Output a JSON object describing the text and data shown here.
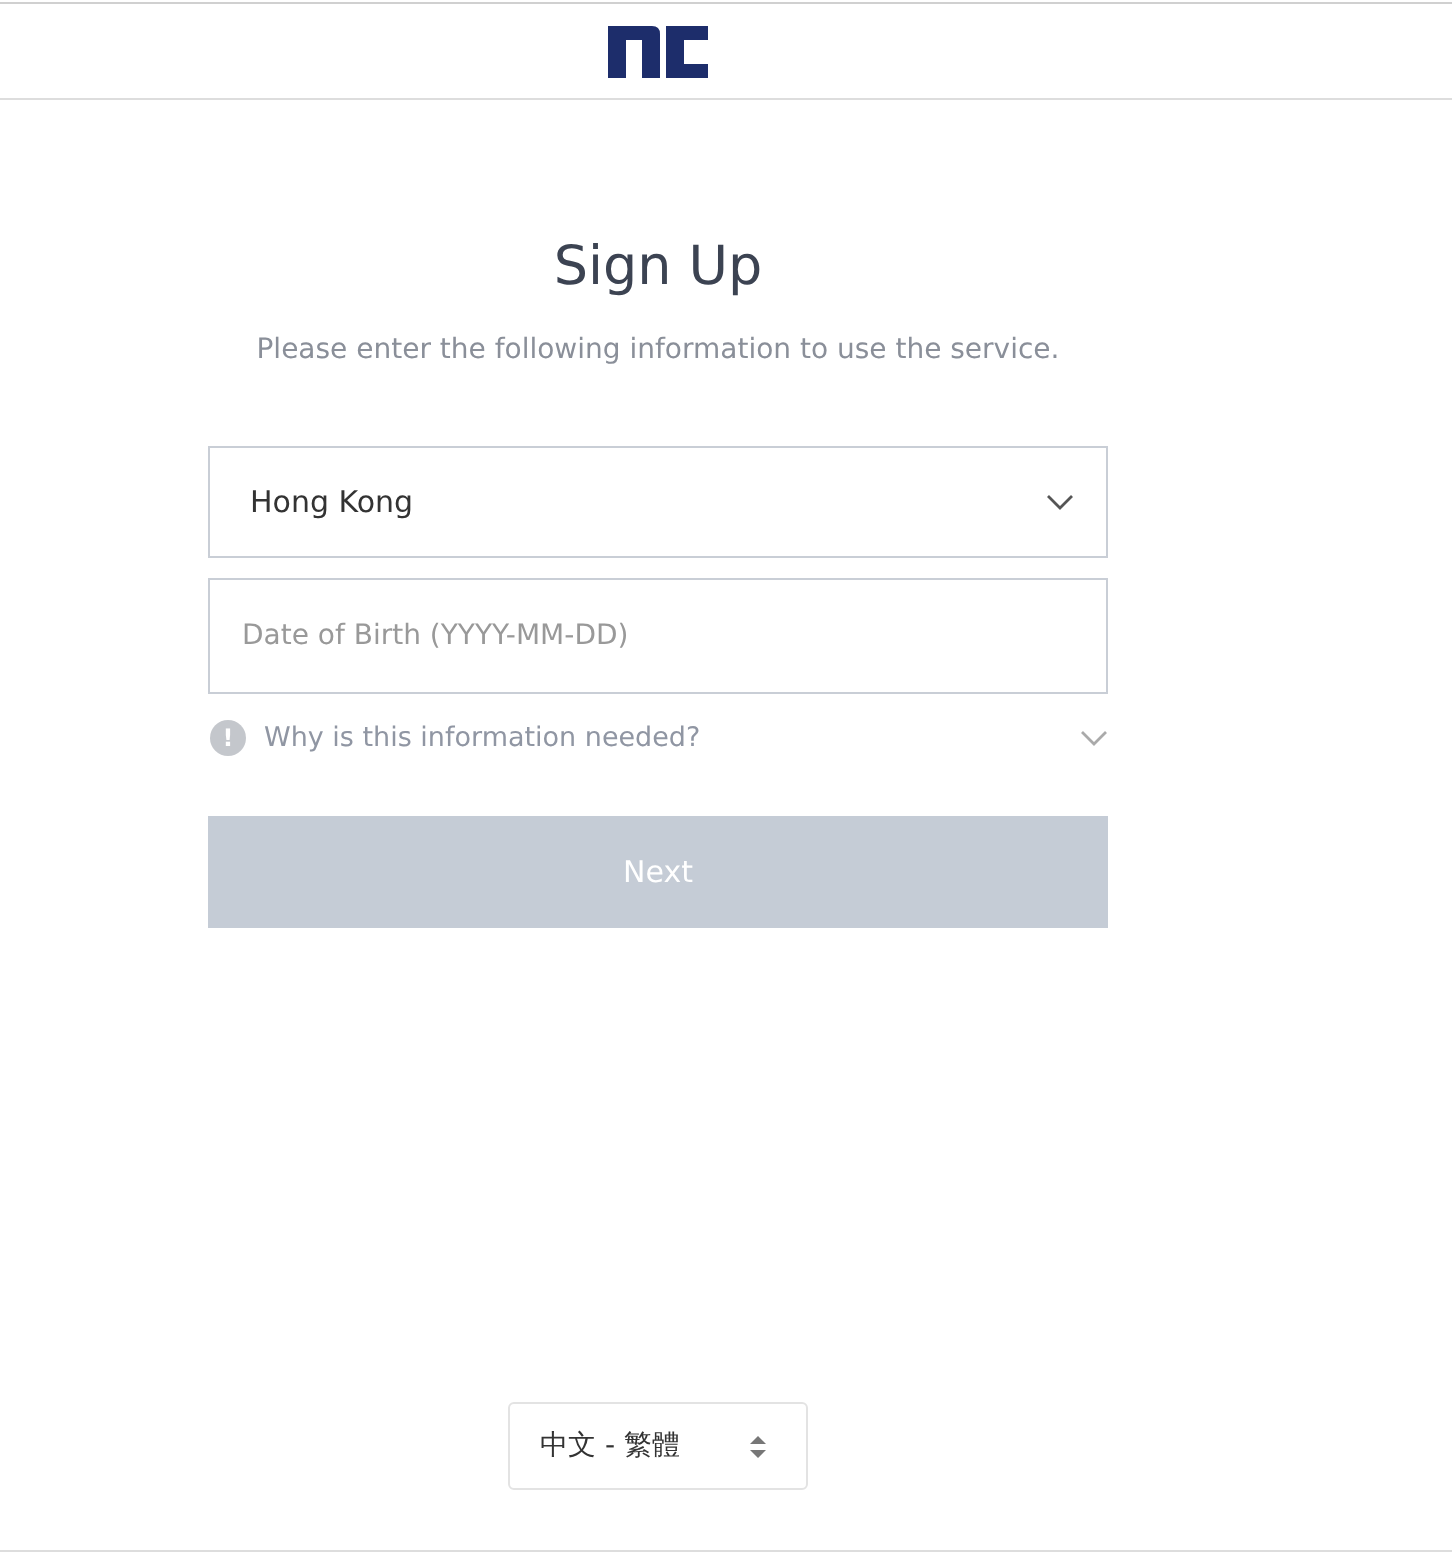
{
  "title": "Sign Up",
  "subtitle": "Please enter the following information to use the service.",
  "country_select": {
    "value": "Hong Kong"
  },
  "birth_date": {
    "placeholder": "Date of Birth (YYYY-MM-DD)"
  },
  "info_toggle": {
    "icon": "!",
    "label": "Why is this information needed?",
    "expanded": false
  },
  "next_button": {
    "label": "Next",
    "disabled": true
  },
  "language_select": {
    "value": "中文 - 繁體"
  }
}
